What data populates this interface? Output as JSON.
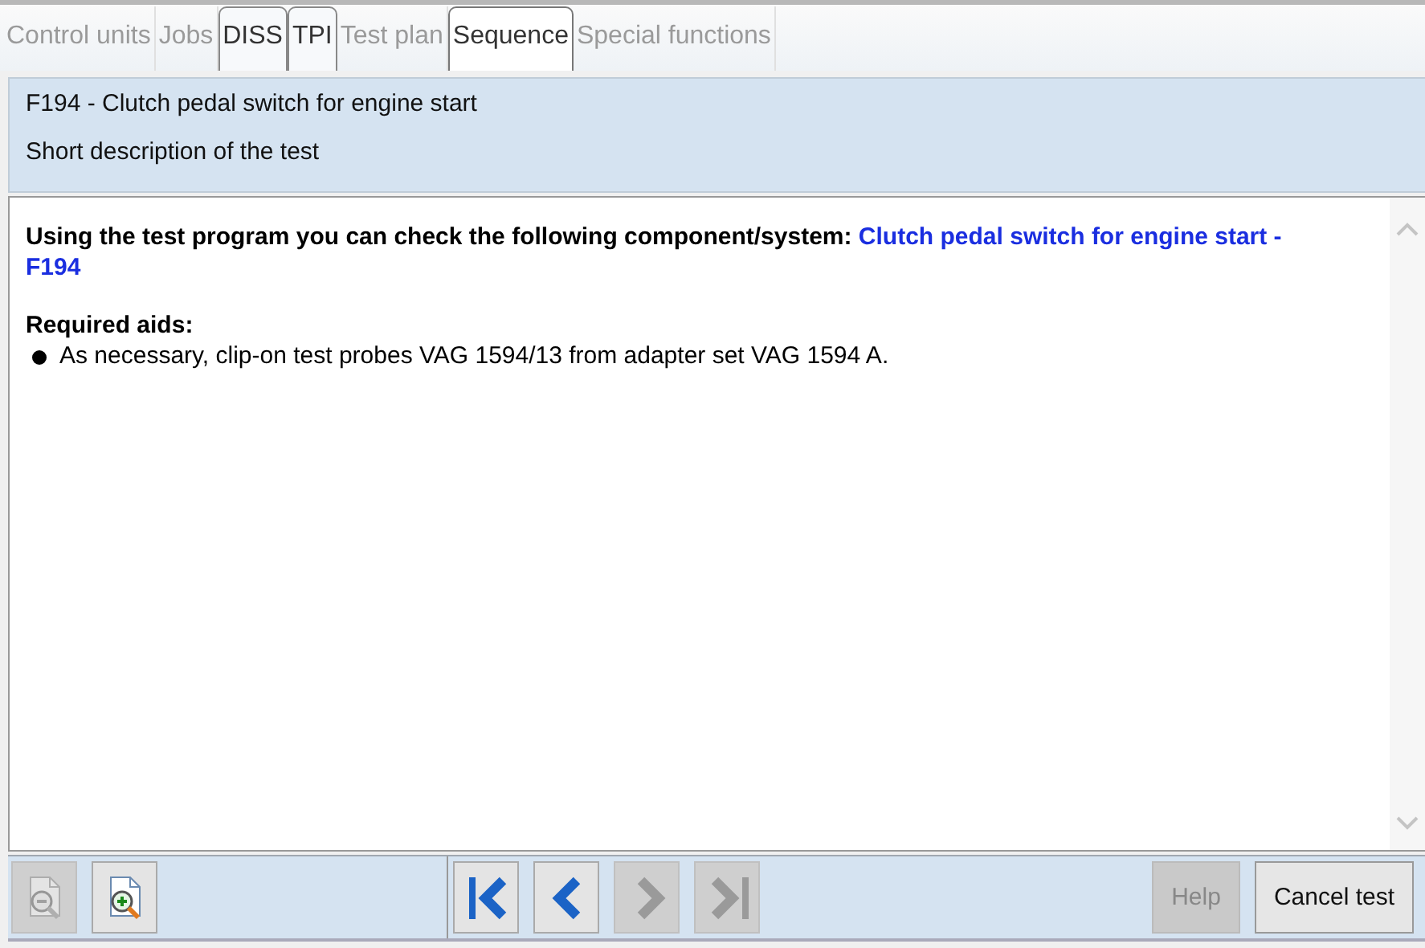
{
  "tabs": [
    {
      "label": "Control units",
      "disabled": true,
      "selected": false
    },
    {
      "label": "Jobs",
      "disabled": true,
      "selected": false
    },
    {
      "label": "DISS",
      "disabled": false,
      "selected": false
    },
    {
      "label": "TPI",
      "disabled": false,
      "selected": false
    },
    {
      "label": "Test plan",
      "disabled": true,
      "selected": false
    },
    {
      "label": "Sequence",
      "disabled": false,
      "selected": true
    },
    {
      "label": "Special functions",
      "disabled": true,
      "selected": false
    }
  ],
  "header": {
    "title": "F194 - Clutch pedal switch for engine start",
    "subtitle": "Short description of the test"
  },
  "content": {
    "intro": "Using the test program you can check the following component/system:",
    "component": "Clutch pedal switch for engine start - F194",
    "aids_heading": "Required aids:",
    "aids": [
      "As necessary, clip-on test probes VAG 1594/13 from adapter set VAG 1594 A."
    ]
  },
  "toolbar": {
    "zoom": [
      {
        "kind": "zoom-out",
        "disabled": true
      },
      {
        "kind": "zoom-in",
        "disabled": false
      }
    ],
    "navigation": [
      {
        "kind": "first",
        "disabled": false
      },
      {
        "kind": "previous",
        "disabled": false
      },
      {
        "kind": "next",
        "disabled": true
      },
      {
        "kind": "last",
        "disabled": true
      }
    ],
    "buttons": [
      {
        "label": "Help",
        "disabled": true
      },
      {
        "label": "Cancel test",
        "disabled": false
      }
    ]
  }
}
